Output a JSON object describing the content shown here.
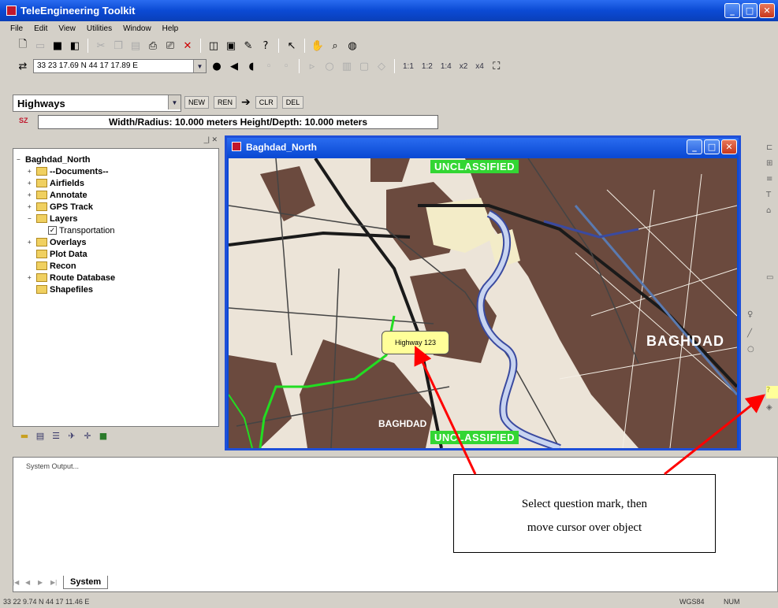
{
  "app": {
    "title": "TeleEngineering Toolkit",
    "window_buttons": [
      "_",
      "□",
      "✕"
    ]
  },
  "menu": [
    "File",
    "Edit",
    "View",
    "Utilities",
    "Window",
    "Help"
  ],
  "toolbar2": {
    "coordinate": "33 23 17.69 N 44 17 17.89 E",
    "scales": [
      "1:1",
      "1:2",
      "1:4",
      "x2",
      "x4"
    ]
  },
  "toolbar3": {
    "layer_select": "Highways",
    "buttons": [
      "NEW",
      "REN",
      "CLR",
      "DEL"
    ]
  },
  "dimension": {
    "icon": "SZ",
    "text": "Width/Radius: 10.000 meters Height/Depth: 10.000 meters"
  },
  "tree": {
    "items": [
      {
        "label": "Baghdad_North",
        "level": 0,
        "type": "root"
      },
      {
        "label": "--Documents--",
        "level": 1,
        "type": "folder",
        "expandable": true
      },
      {
        "label": "Airfields",
        "level": 1,
        "type": "folder",
        "expandable": true
      },
      {
        "label": "Annotate",
        "level": 1,
        "type": "folder",
        "expandable": true
      },
      {
        "label": "GPS Track",
        "level": 1,
        "type": "folder",
        "expandable": true
      },
      {
        "label": "Layers",
        "level": 1,
        "type": "folder",
        "expandable": true
      },
      {
        "label": "Transportation",
        "level": 2,
        "type": "check",
        "checked": true
      },
      {
        "label": "Overlays",
        "level": 1,
        "type": "folder",
        "expandable": true
      },
      {
        "label": "Plot Data",
        "level": 1,
        "type": "folder",
        "expandable": false
      },
      {
        "label": "Recon",
        "level": 1,
        "type": "folder",
        "expandable": false
      },
      {
        "label": "Route Database",
        "level": 1,
        "type": "folder",
        "expandable": true
      },
      {
        "label": "Shapefiles",
        "level": 1,
        "type": "folder",
        "expandable": false
      }
    ]
  },
  "map_window": {
    "title": "Baghdad_North",
    "classification": "UNCLASSIFIED",
    "tooltip": "Highway 123",
    "city_label": "BAGHDAD",
    "bottom_label": "BAGHDAD"
  },
  "system": {
    "output_label": "System Output...",
    "tab": "System"
  },
  "status": {
    "coordinate": "33 22 9.74 N 44 17 11.46 E",
    "datum": "WGS84",
    "num": "NUM"
  },
  "callout": {
    "line1": "Select question mark, then",
    "line2": "move cursor over object"
  },
  "colors": {
    "titlebar": "#0b4ad4",
    "classification": "#33d633",
    "route": "#22dd22",
    "arrow": "#ff0000",
    "urban": "#6b4a3e"
  }
}
